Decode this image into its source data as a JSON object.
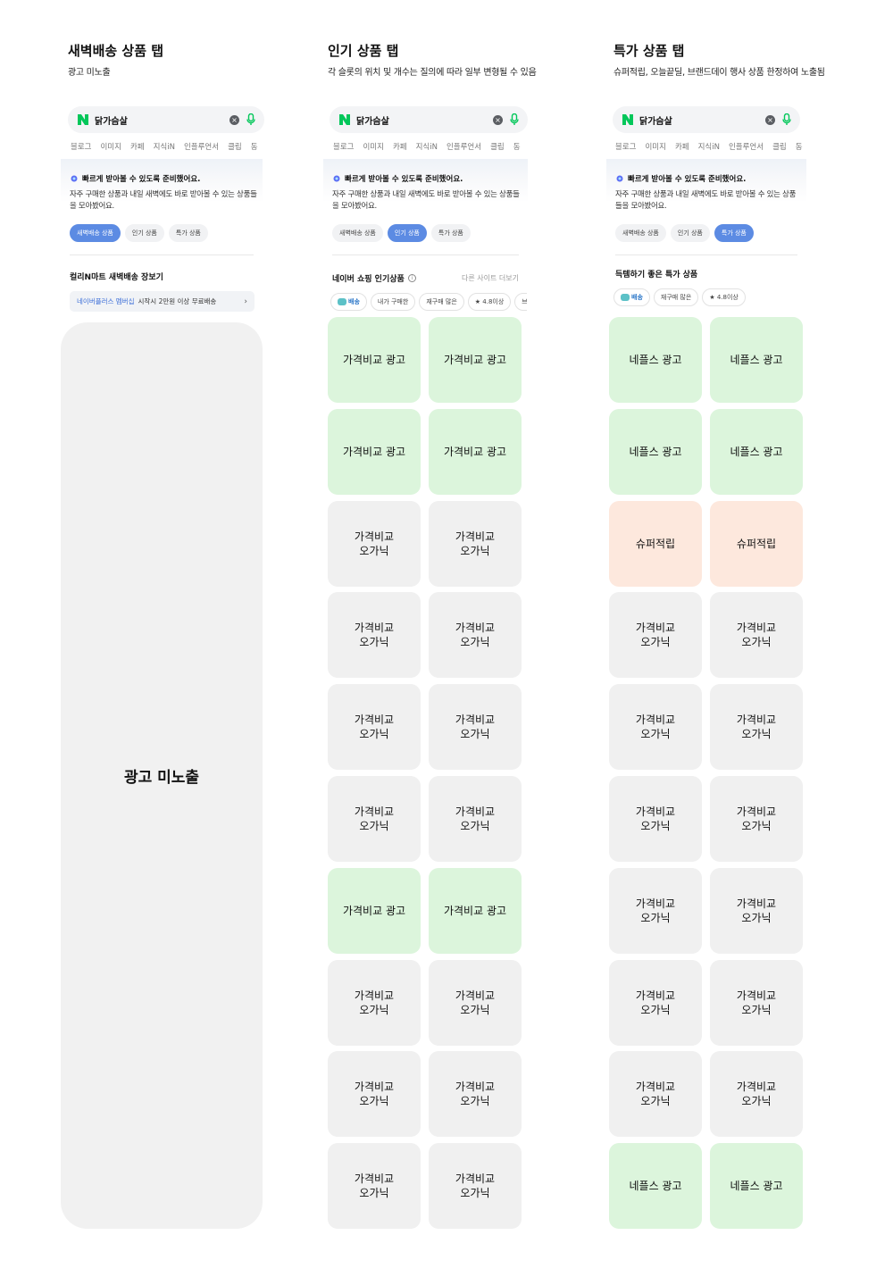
{
  "search": {
    "query": "닭가슴살",
    "tabs": [
      "블로그",
      "이미지",
      "카페",
      "지식iN",
      "인플루언서",
      "클립",
      "동"
    ]
  },
  "card": {
    "headline": "빠르게 받아볼 수 있도록 준비했어요.",
    "desc": "자주 구매한 상품과 내일 새벽에도 바로 받아볼 수 있는 상품들을 모아봤어요.",
    "chips": [
      "새벽배송 상품",
      "인기 상품",
      "특가 상품"
    ]
  },
  "columns": [
    {
      "title": "새벽배송 상품 탭",
      "subtitle": "광고 미노출",
      "active_chip": 0,
      "section_title": "컬리N마트 새벽배송 장보기",
      "banner": {
        "highlight": "네이버플러스 멤버십",
        "text": "시작시 2만원 이상 무료배송"
      },
      "placeholder": "광고 미노출"
    },
    {
      "title": "인기 상품 탭",
      "subtitle": "각 슬롯의 위치 및 개수는 질의에 따라 일부 변형될 수 있음",
      "active_chip": 1,
      "section_title": "네이버 쇼핑 인기상품",
      "more_link": "다른 사이트 더보기",
      "filters": [
        "배송",
        "내가 구매한",
        "재구매 많은",
        "★ 4.8이상",
        "브"
      ],
      "tiles": [
        [
          "가격비교 광고",
          "ad"
        ],
        [
          "가격비교 광고",
          "ad"
        ],
        [
          "가격비교 광고",
          "ad"
        ],
        [
          "가격비교 광고",
          "ad"
        ],
        [
          "가격비교\n오가닉",
          "organic"
        ],
        [
          "가격비교\n오가닉",
          "organic"
        ],
        [
          "가격비교\n오가닉",
          "organic"
        ],
        [
          "가격비교\n오가닉",
          "organic"
        ],
        [
          "가격비교\n오가닉",
          "organic"
        ],
        [
          "가격비교\n오가닉",
          "organic"
        ],
        [
          "가격비교\n오가닉",
          "organic"
        ],
        [
          "가격비교\n오가닉",
          "organic"
        ],
        [
          "가격비교 광고",
          "ad"
        ],
        [
          "가격비교 광고",
          "ad"
        ],
        [
          "가격비교\n오가닉",
          "organic"
        ],
        [
          "가격비교\n오가닉",
          "organic"
        ],
        [
          "가격비교\n오가닉",
          "organic"
        ],
        [
          "가격비교\n오가닉",
          "organic"
        ],
        [
          "가격비교\n오가닉",
          "organic"
        ],
        [
          "가격비교\n오가닉",
          "organic"
        ]
      ]
    },
    {
      "title": "특가 상품 탭",
      "subtitle": "슈퍼적립, 오늘끝딜, 브랜드데이 행사 상품 한정하여 노출됨",
      "active_chip": 2,
      "section_title": "득템하기 좋은 특가 상품",
      "filters": [
        "배송",
        "재구매 많은",
        "★ 4.8이상"
      ],
      "tiles": [
        [
          "네플스 광고",
          "ad"
        ],
        [
          "네플스 광고",
          "ad"
        ],
        [
          "네플스 광고",
          "ad"
        ],
        [
          "네플스 광고",
          "ad"
        ],
        [
          "슈퍼적립",
          "super"
        ],
        [
          "슈퍼적립",
          "super"
        ],
        [
          "가격비교\n오가닉",
          "organic"
        ],
        [
          "가격비교\n오가닉",
          "organic"
        ],
        [
          "가격비교\n오가닉",
          "organic"
        ],
        [
          "가격비교\n오가닉",
          "organic"
        ],
        [
          "가격비교\n오가닉",
          "organic"
        ],
        [
          "가격비교\n오가닉",
          "organic"
        ],
        [
          "가격비교\n오가닉",
          "organic"
        ],
        [
          "가격비교\n오가닉",
          "organic"
        ],
        [
          "가격비교\n오가닉",
          "organic"
        ],
        [
          "가격비교\n오가닉",
          "organic"
        ],
        [
          "가격비교\n오가닉",
          "organic"
        ],
        [
          "가격비교\n오가닉",
          "organic"
        ],
        [
          "네플스 광고",
          "ad"
        ],
        [
          "네플스 광고",
          "ad"
        ]
      ]
    }
  ],
  "colors": {
    "ad": "#dcf5dc",
    "organic": "#f0f0f0",
    "super": "#fde8dd",
    "active_chip": "#5c8be3",
    "naver_green": "#03c75a"
  }
}
